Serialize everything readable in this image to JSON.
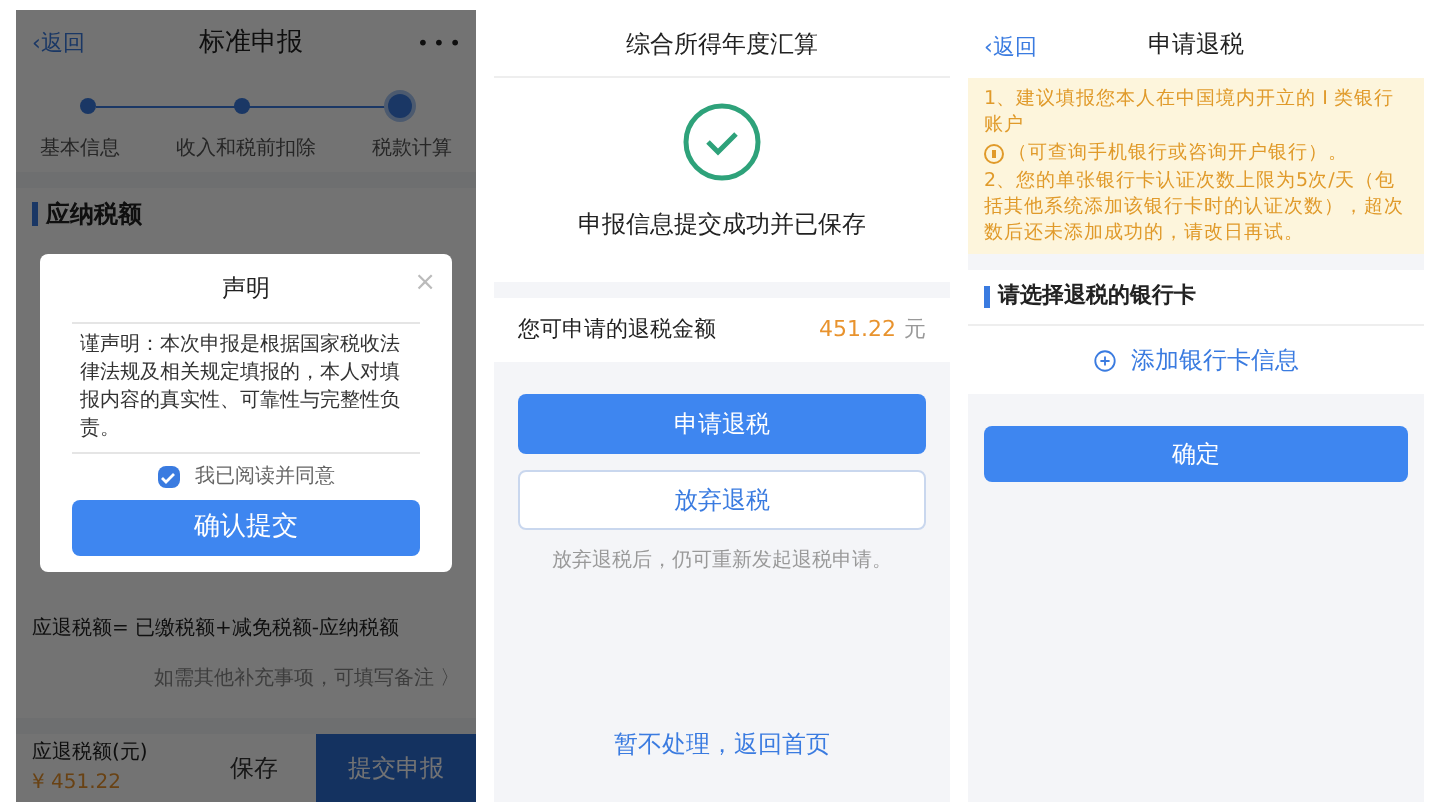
{
  "screen_1": {
    "back_arrow": "‹",
    "back": "返回",
    "title": "标准申报",
    "more": "• • •",
    "steps": [
      {
        "label": "基本信息",
        "selected": false
      },
      {
        "label": "收入和税前扣除",
        "selected": false
      },
      {
        "label": "税款计算",
        "selected": true
      }
    ],
    "section_title": "应纳税额",
    "formula": "应退税额= 已缴税额+减免税额-应纳税额",
    "remark_link": "如需其他补充事项，可填写备注 〉",
    "footer": {
      "label": "应退税额(元)",
      "amount": "¥ 451.22",
      "save": "保存",
      "submit": "提交申报"
    },
    "dialog": {
      "title": "声明",
      "close": "×",
      "body": "谨声明：本次申报是根据国家税收法律法规及相关规定填报的，本人对填报内容的真实性、可靠性与完整性负责。",
      "agree": {
        "label": "我已阅读并同意",
        "checked": true
      },
      "confirm": "确认提交"
    }
  },
  "screen_2": {
    "title": "综合所得年度汇算",
    "success": "申报信息提交成功并已保存",
    "refund_label": "您可申请的退税金额",
    "refund_amount": "451.22",
    "unit": "元",
    "apply": "申请退税",
    "abandon": "放弃退税",
    "abandon_hint": "放弃退税后，仍可重新发起退税申请。",
    "later": "暂不处理，返回首页"
  },
  "screen_3": {
    "back_arrow": "‹",
    "back": "返回",
    "title": "申请退税",
    "notice_1_before": "1、建议填报您本人在中国境内开立的 I 类银行账户",
    "notice_1_after": "（可查询手机银行或咨询开户银行）。",
    "notice_2": "2、您的单张银行卡认证次数上限为5次/天（包括其他系统添加该银行卡时的认证次数），超次数后还未添加成功的，请改日再试。",
    "section_title": "请选择退税的银行卡",
    "add_card": "添加银行卡信息",
    "confirm": "确定"
  }
}
